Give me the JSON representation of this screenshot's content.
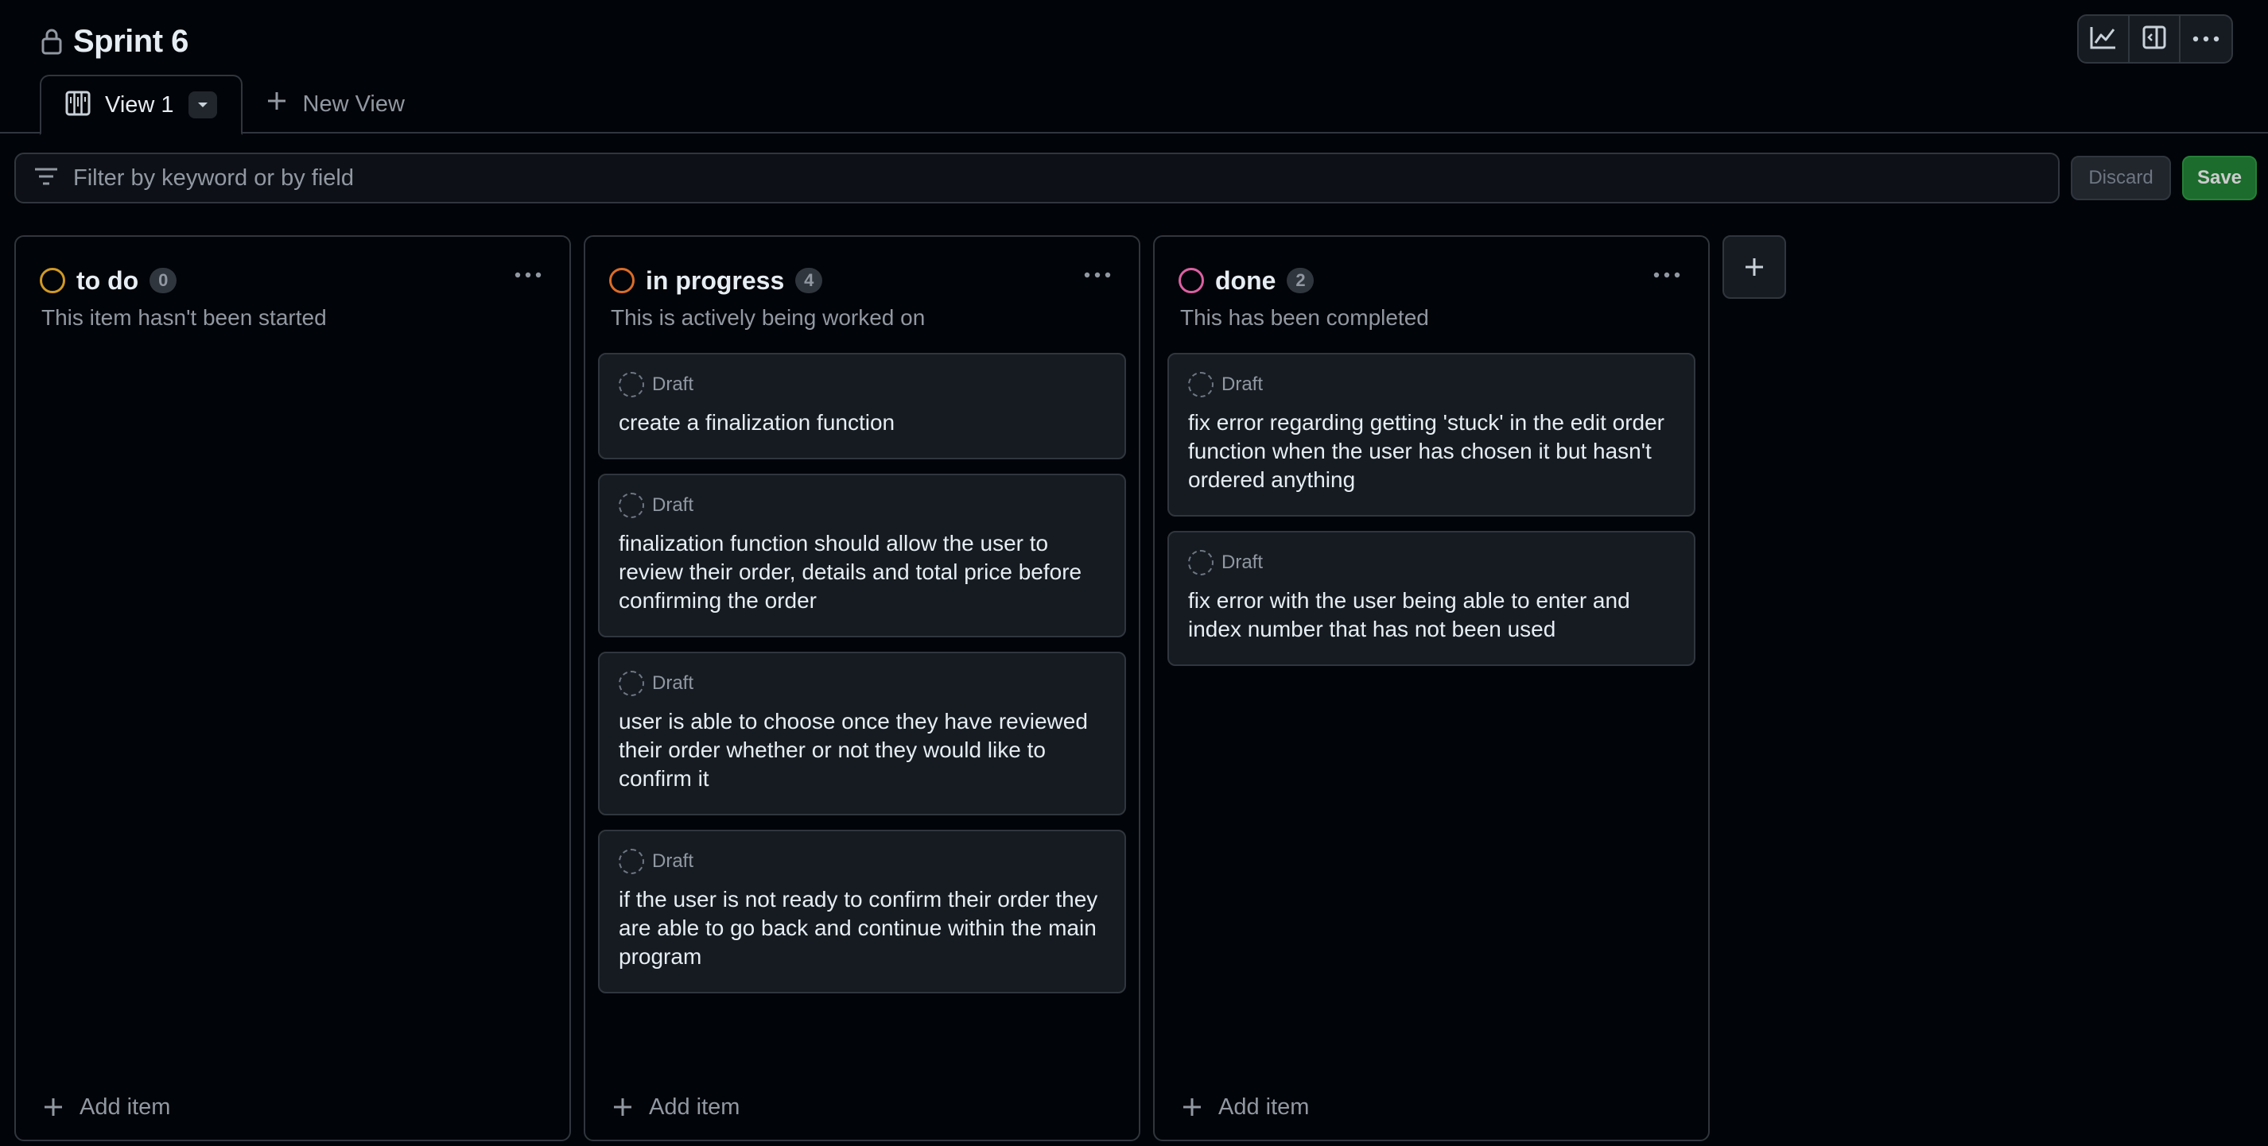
{
  "project": {
    "title": "Sprint 6",
    "lock_icon": "lock-icon"
  },
  "toolbar": {
    "insights_icon": "graph-icon",
    "side_panel_icon": "sidebar-expand-icon",
    "more_icon": "kebab-horizontal-icon"
  },
  "tabs": {
    "active": {
      "label": "View 1",
      "icon": "board-layout-icon"
    },
    "new_view": {
      "label": "New View",
      "icon": "plus-icon"
    }
  },
  "filter": {
    "placeholder": "Filter by keyword or by field",
    "discard_label": "Discard",
    "save_label": "Save"
  },
  "columns": [
    {
      "name": "to do",
      "count": "0",
      "description": "This item hasn't been started",
      "color": "#d29922",
      "add_item_label": "Add item",
      "cards": []
    },
    {
      "name": "in progress",
      "count": "4",
      "description": "This is actively being worked on",
      "color": "#db6d28",
      "add_item_label": "Add item",
      "cards": [
        {
          "type": "Draft",
          "title": "create a finalization function"
        },
        {
          "type": "Draft",
          "title": "finalization function should allow the user to review their order, details and total price before confirming the order"
        },
        {
          "type": "Draft",
          "title": "user is able to choose once they have reviewed their order whether or not they would like to confirm it"
        },
        {
          "type": "Draft",
          "title": "if the user is not ready to confirm their order they are able to go back and continue within the main program"
        }
      ]
    },
    {
      "name": "done",
      "count": "2",
      "description": "This has been completed",
      "color": "#db61a2",
      "add_item_label": "Add item",
      "cards": [
        {
          "type": "Draft",
          "title": "fix error regarding getting 'stuck' in the edit order function when the user has chosen it but hasn't ordered anything"
        },
        {
          "type": "Draft",
          "title": "fix error with the user being able to enter and index number that has not been used"
        }
      ]
    }
  ]
}
